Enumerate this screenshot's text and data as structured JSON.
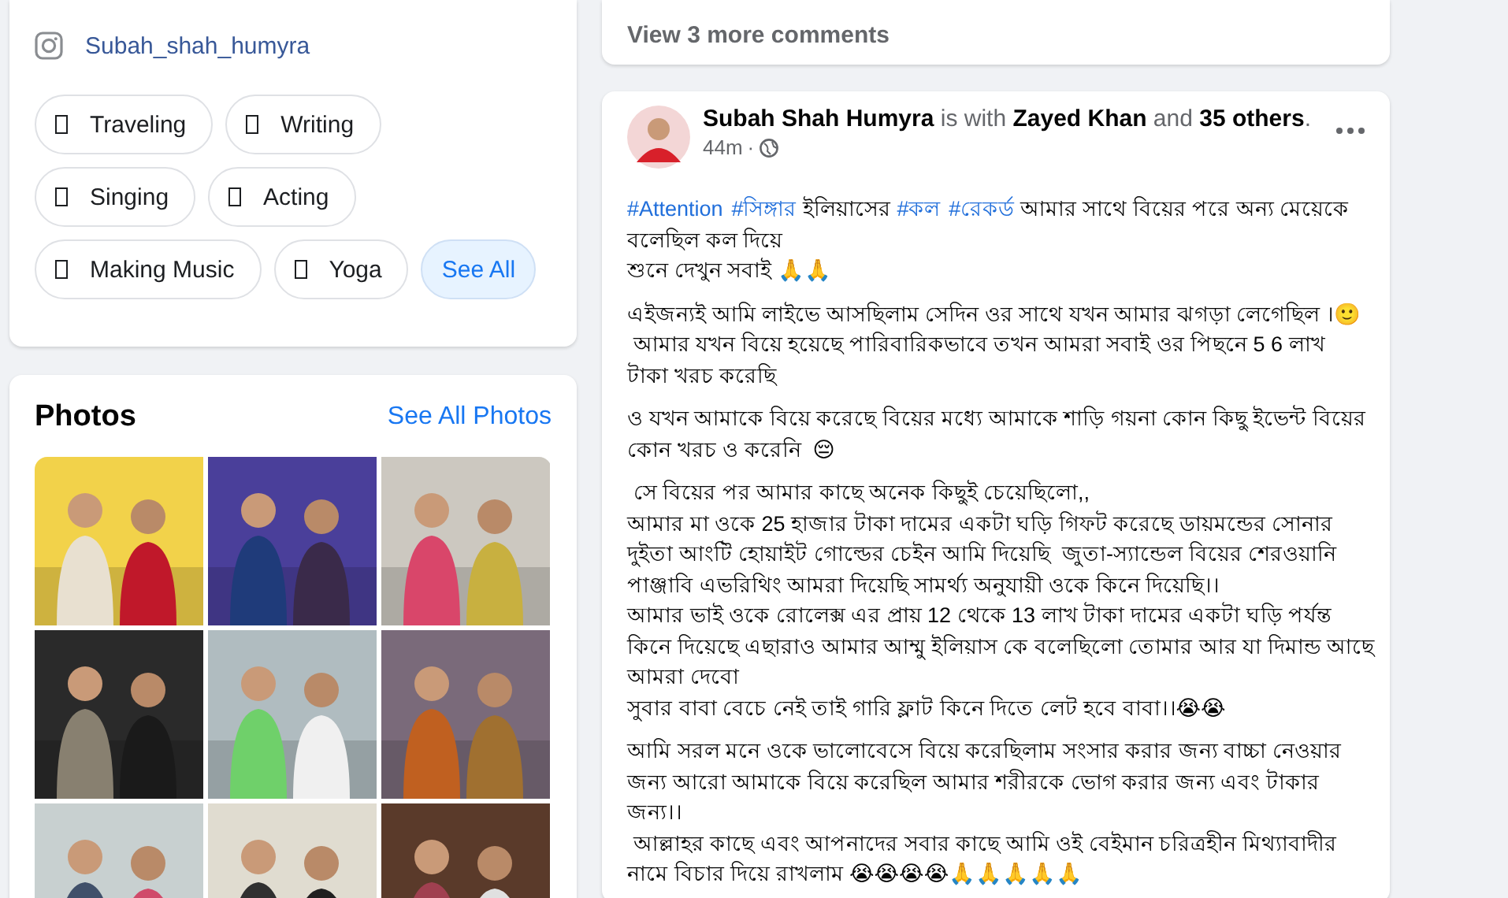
{
  "intro": {
    "instagram": "Subah_shah_humyra",
    "hobbies": [
      {
        "label": "Traveling"
      },
      {
        "label": "Writing"
      },
      {
        "label": "Singing"
      },
      {
        "label": "Acting"
      },
      {
        "label": "Making Music"
      },
      {
        "label": "Yoga"
      }
    ],
    "see_all": "See All"
  },
  "photos": {
    "title": "Photos",
    "see_all": "See All Photos"
  },
  "previous_post": {
    "more_comments": "View 3 more comments"
  },
  "post": {
    "headline": "**Subah Shah Humyra** is with **Zayed Khan** and **35 others**.",
    "time": "44m",
    "separator": "·",
    "paragraphs": [
      [
        {
          "segments": [
            {
              "text": "#Attention",
              "hashtag": true
            },
            {
              "text": "#সিঙ্গার",
              "hashtag": true
            },
            {
              "text": " ইলিয়াসের ",
              "hashtag": false
            },
            {
              "text": "#কল",
              "hashtag": true
            },
            {
              "text": "#রেকর্ড",
              "hashtag": true
            },
            {
              "text": " আমার সাথে বিয়ের পরে অন্য মেয়েকে",
              "hashtag": false
            }
          ]
        },
        {
          "text": "বলেছিল কল দিয়ে"
        },
        {
          "text": "শুনে দেখুন সবাই 🙏🙏"
        }
      ],
      [
        {
          "text": "এইজন্যই আমি লাইভে আসছিলাম সেদিন ওর সাথে যখন আমার ঝগড়া লেগেছিল ।🙂"
        },
        {
          "text": " আমার যখন বিয়ে হয়েছে পারিবারিকভাবে তখন আমরা সবাই ওর পিছনে 5 6 লাখ"
        },
        {
          "text": "টাকা খরচ করেছি"
        }
      ],
      [
        {
          "text": "ও যখন আমাকে বিয়ে করেছে বিয়ের মধ্যে আমাকে শাড়ি গয়না কোন কিছু ইভেন্ট বিয়ের"
        },
        {
          "text": "কোন খরচ ও করেনি  😔"
        }
      ],
      [
        {
          "text": " সে বিয়ের পর আমার কাছে অনেক কিছুই চেয়েছিলো,,"
        },
        {
          "text": "আমার মা ওকে 25 হাজার টাকা দামের একটা ঘড়ি গিফট করেছে ডায়মন্ডের সোনার"
        },
        {
          "text": "দুইতা আংটি হোয়াইট গোল্ডের চেইন আমি দিয়েছি  জুতা-স্যান্ডেল বিয়ের শেরওয়ানি"
        },
        {
          "text": "পাঞ্জাবি এভরিথিং আমরা দিয়েছি সামর্থ্য অনুযায়ী ওকে কিনে দিয়েছি।।"
        },
        {
          "text": "আমার ভাই ওকে রোলেক্স এর প্রায় 12 থেকে 13 লাখ টাকা দামের একটা ঘড়ি পর্যন্ত"
        },
        {
          "text": "কিনে দিয়েছে এছারাও আমার আম্মু ইলিয়াস কে বলেছিলো তোমার আর যা দিমান্ড আছে"
        },
        {
          "text": "আমরা দেবো"
        },
        {
          "text": "সুবার বাবা বেচে নেই তাই গারি ফ্লাট কিনে দিতে লেট হবে বাবা।।😭😭"
        }
      ],
      [
        {
          "text": "আমি সরল মনে ওকে ভালোবেসে বিয়ে করেছিলাম সংসার করার জন্য বাচ্চা নেওয়ার"
        },
        {
          "text": "জন্য আরো আমাকে বিয়ে করেছিল আমার শরীরকে ভোগ করার জন্য এবং টাকার"
        },
        {
          "text": "জন্য।।"
        },
        {
          "text": " আল্লাহর কাছে এবং আপনাদের সবার কাছে আমি ওই বেইমান চরিত্রহীন মিথ্যাবাদীর"
        },
        {
          "text": "নামে বিচার দিয়ে রাখলাম 😭😭😭😭🙏🙏🙏🙏🙏"
        }
      ]
    ]
  }
}
